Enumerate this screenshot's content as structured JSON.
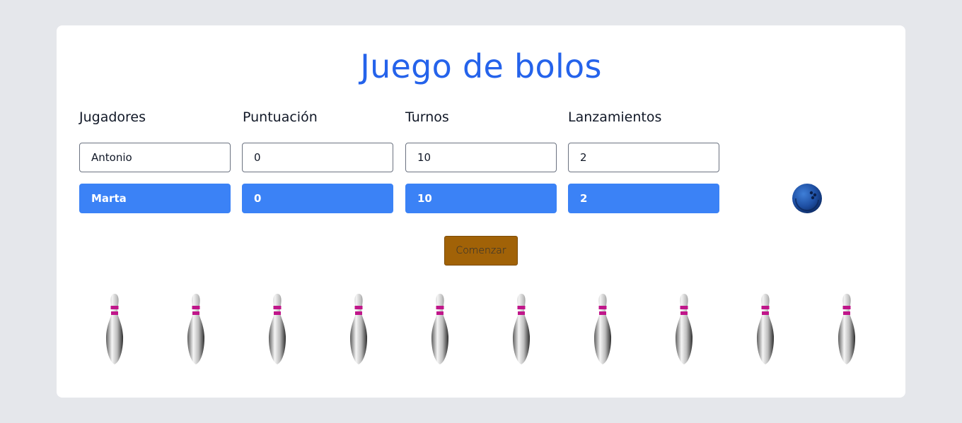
{
  "title": "Juego de bolos",
  "headers": {
    "players": "Jugadores",
    "score": "Puntuación",
    "turns": "Turnos",
    "throws": "Lanzamientos"
  },
  "rows": [
    {
      "player": "Antonio",
      "score": "0",
      "turns": "10",
      "throws": "2",
      "active": false
    },
    {
      "player": "Marta",
      "score": "0",
      "turns": "10",
      "throws": "2",
      "active": true
    }
  ],
  "start_label": "Comenzar",
  "pin_count": 10,
  "colors": {
    "background": "#e5e7eb",
    "title": "#2563eb",
    "active_row": "#3b82f6",
    "start_button": "#a16207",
    "pin_stripe": "#c0168a",
    "ball": "#1e4fa3"
  }
}
